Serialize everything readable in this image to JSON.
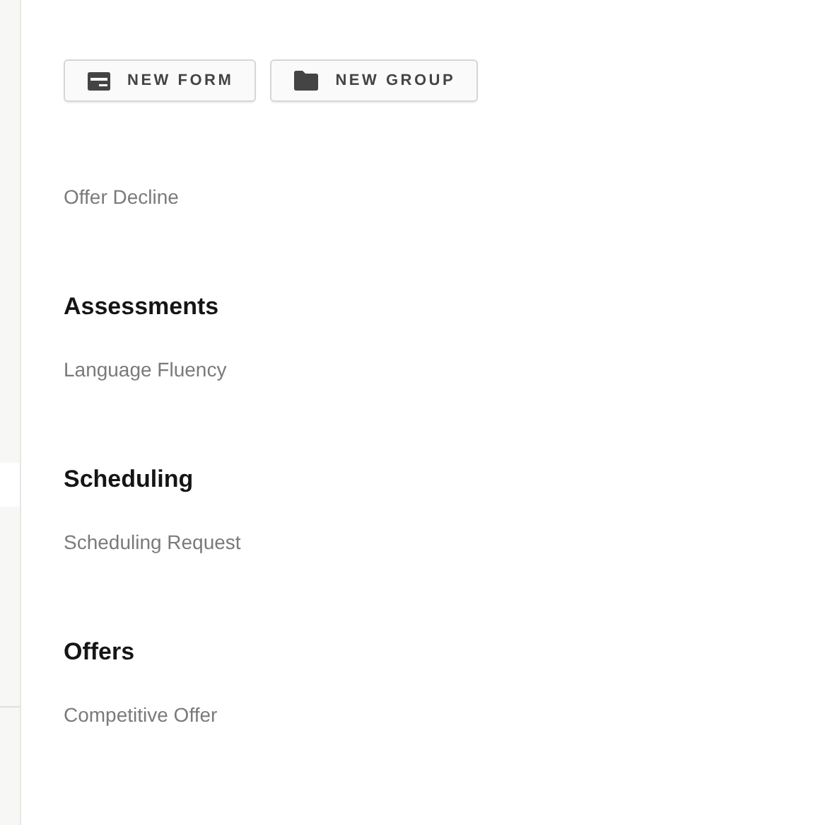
{
  "buttons": [
    {
      "kind": "form",
      "label": "NEW FORM"
    },
    {
      "kind": "group",
      "label": "NEW GROUP"
    }
  ],
  "groups": [
    {
      "items": [
        "Offer Decline"
      ]
    },
    {
      "title": "Assessments",
      "items": [
        "Language Fluency"
      ]
    },
    {
      "title": "Scheduling",
      "items": [
        "Scheduling Request"
      ]
    },
    {
      "title": "Offers",
      "items": [
        "Competitive Offer"
      ]
    }
  ]
}
